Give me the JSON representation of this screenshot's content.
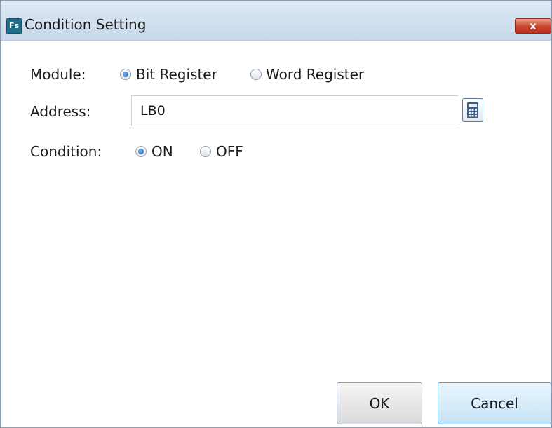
{
  "window": {
    "title": "Condition Setting",
    "app_icon_text": "Fs",
    "close_glyph": "x"
  },
  "module": {
    "label": "Module:",
    "options": [
      {
        "label": "Bit Register",
        "selected": true
      },
      {
        "label": "Word Register",
        "selected": false
      }
    ]
  },
  "address": {
    "label": "Address:",
    "value": "LB0",
    "picker_icon": "calculator-icon"
  },
  "condition": {
    "label": "Condition:",
    "options": [
      {
        "label": "ON",
        "selected": true
      },
      {
        "label": "OFF",
        "selected": false
      }
    ]
  },
  "buttons": {
    "ok_label": "OK",
    "cancel_label": "Cancel"
  },
  "colors": {
    "titlebar": "#c8d8ea",
    "close_button": "#c9442c",
    "radio_selected": "#1c5fb0"
  }
}
